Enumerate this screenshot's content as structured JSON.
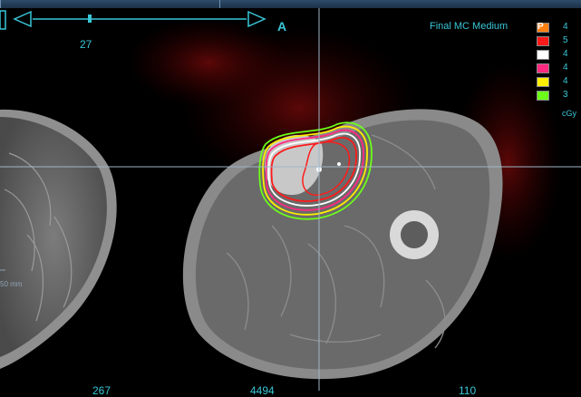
{
  "slider": {
    "value": "27"
  },
  "orientation": {
    "label": "A"
  },
  "dose_panel": {
    "title": "Final MC Medium",
    "badge": "P",
    "unit": "cGy",
    "levels": [
      {
        "value": "4",
        "color": "#ff7f11"
      },
      {
        "value": "5",
        "color": "#ff1a1a"
      },
      {
        "value": "4",
        "color": "#ffffff"
      },
      {
        "value": "4",
        "color": "#ff2a7f"
      },
      {
        "value": "4",
        "color": "#ffee00"
      },
      {
        "value": "3",
        "color": "#6cff1a"
      }
    ]
  },
  "scale_bar": {
    "label": "50 mm"
  },
  "bottom_readouts": {
    "left": "267",
    "center": "4494",
    "right": "110"
  }
}
